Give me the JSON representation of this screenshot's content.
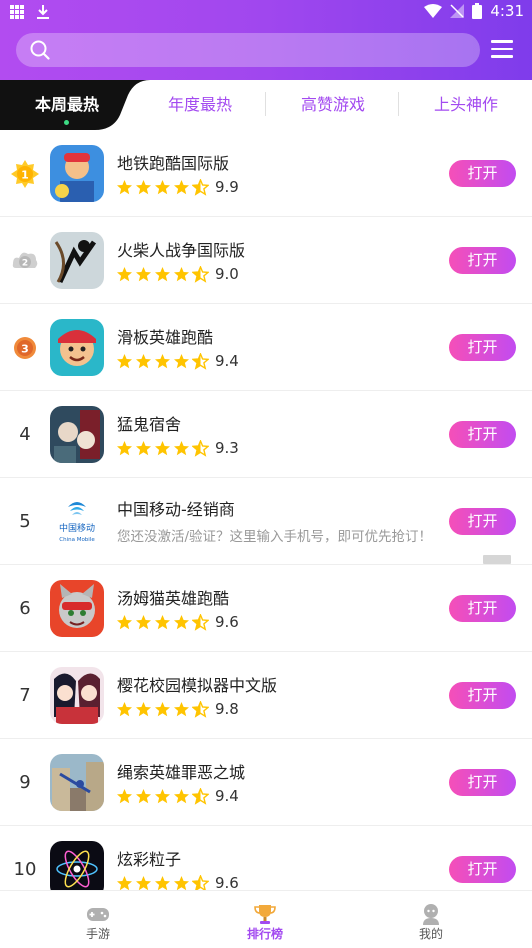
{
  "status_bar": {
    "time": "4:31"
  },
  "search": {
    "placeholder": ""
  },
  "tabs": [
    {
      "label": "本周最热",
      "active": true
    },
    {
      "label": "年度最热",
      "active": false
    },
    {
      "label": "高赞游戏",
      "active": false
    },
    {
      "label": "上头神作",
      "active": false
    }
  ],
  "apps": [
    {
      "rank": "1",
      "title": "地铁跑酷国际版",
      "rating": 4.5,
      "score": "9.9",
      "button": "打开",
      "icon": "subway-surfers-icon"
    },
    {
      "rank": "2",
      "title": "火柴人战争国际版",
      "rating": 4.5,
      "score": "9.0",
      "button": "打开",
      "icon": "stickman-war-icon"
    },
    {
      "rank": "3",
      "title": "滑板英雄跑酷",
      "rating": 4.5,
      "score": "9.4",
      "button": "打开",
      "icon": "skateboard-hero-icon"
    },
    {
      "rank": "4",
      "title": "猛鬼宿舍",
      "rating": 4.5,
      "score": "9.3",
      "button": "打开",
      "icon": "haunted-dorm-icon"
    },
    {
      "rank": "5",
      "title": "中国移动-经销商",
      "description": "您还没激活/验证？这里输入手机号，即可优先抢订！",
      "button": "打开",
      "icon": "china-mobile-icon",
      "icon_text": "中国移动",
      "icon_subtext": "China Mobile"
    },
    {
      "rank": "6",
      "title": "汤姆猫英雄跑酷",
      "rating": 4.5,
      "score": "9.6",
      "button": "打开",
      "icon": "tom-hero-run-icon"
    },
    {
      "rank": "7",
      "title": "樱花校园模拟器中文版",
      "rating": 4.5,
      "score": "9.8",
      "button": "打开",
      "icon": "sakura-school-icon"
    },
    {
      "rank": "9",
      "title": "绳索英雄罪恶之城",
      "rating": 4.5,
      "score": "9.4",
      "button": "打开",
      "icon": "rope-hero-icon"
    },
    {
      "rank": "10",
      "title": "炫彩粒子",
      "rating": 4.5,
      "score": "9.6",
      "button": "打开",
      "icon": "color-particles-icon"
    }
  ],
  "bottom_nav": [
    {
      "label": "手游",
      "icon": "gamepad-icon",
      "active": false
    },
    {
      "label": "排行榜",
      "icon": "trophy-icon",
      "active": true
    },
    {
      "label": "我的",
      "icon": "user-icon",
      "active": false
    }
  ],
  "colors": {
    "accent": "#a34af0",
    "button_start": "#f54fb8",
    "button_end": "#c24cf0",
    "star": "#ffc400"
  }
}
